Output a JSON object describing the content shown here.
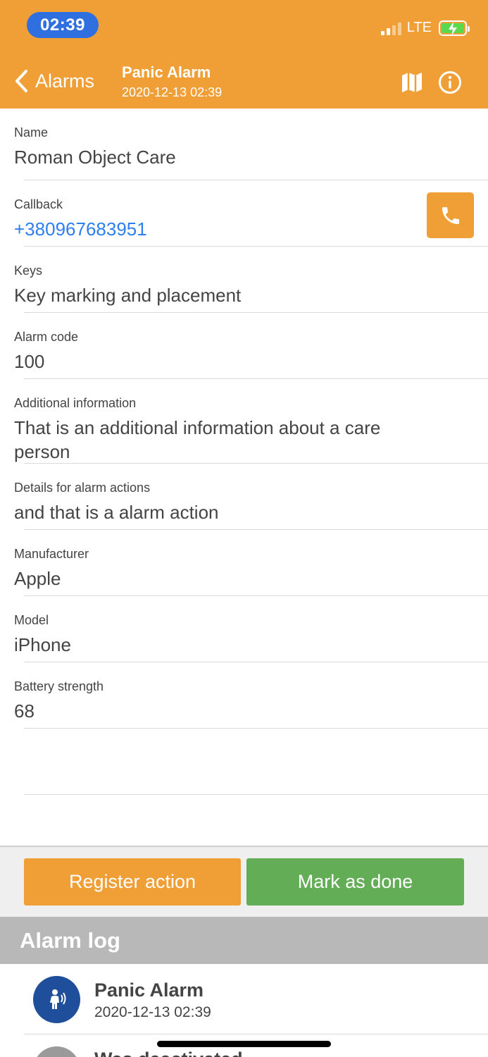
{
  "status_bar": {
    "time": "02:39",
    "network": "LTE"
  },
  "header": {
    "back_label": "Alarms",
    "title": "Panic Alarm",
    "subtitle": "2020-12-13 02:39",
    "background_color": "#f09e36",
    "icons": [
      "map-icon",
      "info-icon"
    ]
  },
  "details": {
    "name": {
      "label": "Name",
      "value": "Roman Object Care"
    },
    "callback": {
      "label": "Callback",
      "value": "+380967683951"
    },
    "keys": {
      "label": "Keys",
      "value": "Key marking and placement"
    },
    "alarm_code": {
      "label": "Alarm code",
      "value": "100"
    },
    "additional_info": {
      "label": "Additional information",
      "value": "That is an additional information about a care person"
    },
    "alarm_actions": {
      "label": "Details for alarm actions",
      "value": "and that is a alarm action"
    },
    "manufacturer": {
      "label": "Manufacturer",
      "value": "Apple"
    },
    "model": {
      "label": "Model",
      "value": "iPhone"
    },
    "battery": {
      "label": "Battery strength",
      "value": "68"
    }
  },
  "actions": {
    "register_label": "Register action",
    "done_label": "Mark as done",
    "register_color": "#f09e36",
    "done_color": "#63ad57"
  },
  "log": {
    "title": "Alarm log",
    "items": [
      {
        "title": "Panic Alarm",
        "time": "2020-12-13 02:39",
        "icon": "panic-person-icon",
        "color": "#1f4f9a"
      },
      {
        "title": "Was deactivated",
        "icon": "status-icon",
        "color": "#9a9a9a"
      }
    ]
  }
}
